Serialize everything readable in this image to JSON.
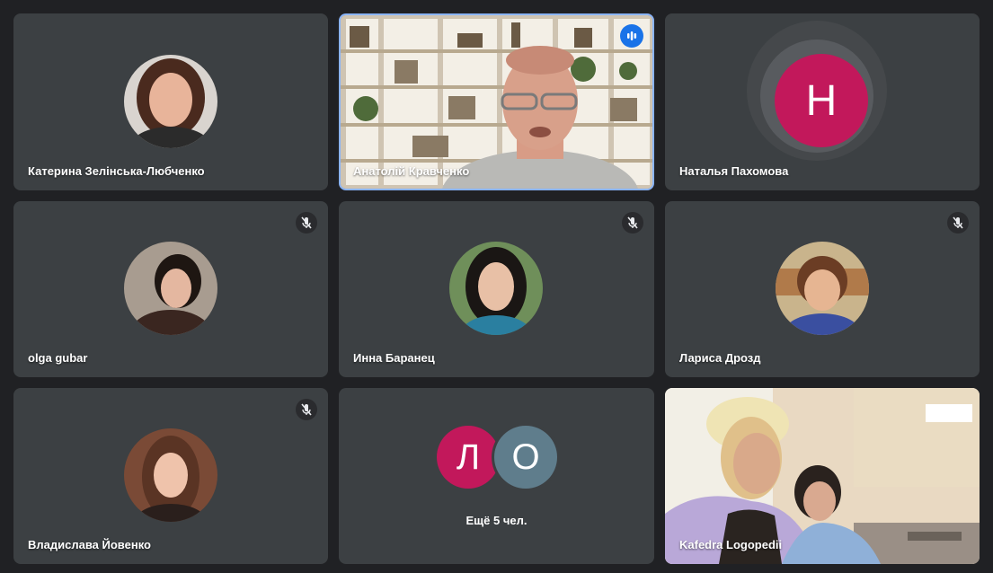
{
  "participants": [
    {
      "name": "Катерина Зелінська-Любченко"
    },
    {
      "name": "Анатолій Кравченко"
    },
    {
      "name": "Наталья Пахомова",
      "initial": "Н"
    },
    {
      "name": "olga gubar"
    },
    {
      "name": "Инна Баранец"
    },
    {
      "name": "Лариса Дрозд"
    },
    {
      "name": "Владислава Йовенко"
    },
    {
      "name": "Kafedra Logopedii"
    }
  ],
  "overflow": {
    "initials": [
      "Л",
      "О"
    ],
    "label": "Ещё 5 чел."
  },
  "colors": {
    "background": "#202124",
    "tile": "#3c4043",
    "active_border": "#8ab4f8",
    "speaking": "#1a73e8",
    "avatar_crimson": "#c2185b",
    "avatar_slate": "#5f7d8c"
  },
  "icons": [
    "mic-off-icon",
    "speaking-indicator-icon"
  ]
}
